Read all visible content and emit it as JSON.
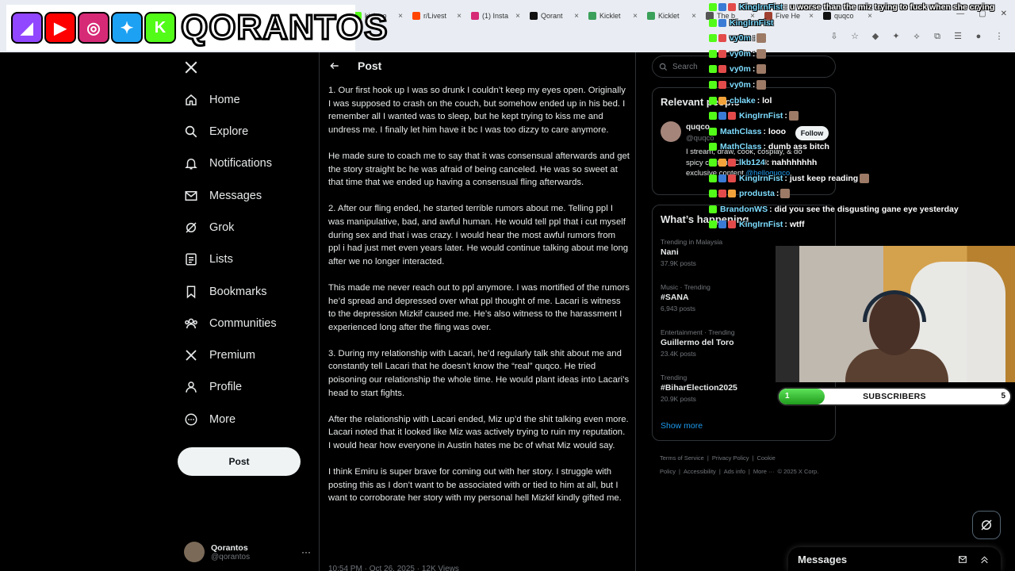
{
  "browser": {
    "tabs": [
      {
        "label": "kick.co",
        "color": "#53fc18"
      },
      {
        "label": "r/Livest",
        "color": "#ff4500"
      },
      {
        "label": "(1) Insta",
        "color": "#d62976"
      },
      {
        "label": "Qorant",
        "color": "#111111"
      },
      {
        "label": "Kicklet",
        "color": "#3aa05a"
      },
      {
        "label": "Kicklet",
        "color": "#3aa05a"
      },
      {
        "label": "The b",
        "color": "#555555"
      },
      {
        "label": "Five He",
        "color": "#a04030"
      },
      {
        "label": "quqco",
        "color": "#111111"
      }
    ]
  },
  "banner": {
    "name": "QORANTOS",
    "socials": [
      {
        "icon": "twitch-icon",
        "color": "#9146ff"
      },
      {
        "icon": "youtube-icon",
        "color": "#ff0000"
      },
      {
        "icon": "instagram-icon",
        "color": "#d62976"
      },
      {
        "icon": "twitter-icon",
        "color": "#1da1f2"
      },
      {
        "icon": "kick-icon",
        "color": "#53fc18"
      }
    ]
  },
  "nav": {
    "items": [
      {
        "label": "Home",
        "icon": "home-icon"
      },
      {
        "label": "Explore",
        "icon": "search-icon"
      },
      {
        "label": "Notifications",
        "icon": "bell-icon"
      },
      {
        "label": "Messages",
        "icon": "mail-icon"
      },
      {
        "label": "Grok",
        "icon": "grok-icon"
      },
      {
        "label": "Lists",
        "icon": "list-icon"
      },
      {
        "label": "Bookmarks",
        "icon": "bookmark-icon"
      },
      {
        "label": "Communities",
        "icon": "communities-icon"
      },
      {
        "label": "Premium",
        "icon": "x-icon"
      },
      {
        "label": "Profile",
        "icon": "profile-icon"
      },
      {
        "label": "More",
        "icon": "more-icon"
      }
    ],
    "post_button": "Post",
    "account": {
      "name": "Qorantos",
      "handle": "@qorantos",
      "more": "···"
    }
  },
  "main": {
    "title": "Post",
    "paragraphs": [
      "1. Our first hook up I was so drunk I couldn’t keep my eyes open. Originally I was supposed to crash on the couch, but somehow ended up in his bed. I remember all I wanted was to sleep, but he kept trying to kiss me and undress me. I finally let him have it bc I was too dizzy to care anymore.",
      "He made sure to coach me to say that it was consensual afterwards and get the story straight bc he was afraid of being canceled. He was so sweet at that time that we ended up having a consensual fling afterwards.",
      "2. After our fling ended, he started terrible rumors about me. Telling ppl I was manipulative, bad, and awful human. He would tell ppl that i cut myself during sex and that i was crazy. I would hear the most awful rumors from ppl i had just met even years later. He would continue talking about me long after we no longer interacted.",
      "This made me never reach out to ppl anymore. I was mortified of the rumors he’d spread and depressed over what ppl thought of me. Lacari is witness to the depression Mizkif caused me. He’s also witness to the harassment I experienced long after the fling was over.",
      "3. During my relationship with Lacari, he’d regularly talk shit about me and constantly tell Lacari that he doesn’t know the “real” quqco.  He tried poisoning our relationship the whole time. He would plant ideas into Lacari’s head to start fights.",
      "After the relationship with Lacari ended, Miz up’d the shit talking even more. Lacari noted that it looked like Miz was actively trying to ruin my reputation. I would hear how everyone in Austin hates me bc of what Miz would say.",
      "I think Emiru is super brave for coming out with her story. I struggle with posting this as I don’t want to be associated with or tied to him at all, but I want to corroborate her story with my personal hell Mizkif kindly gifted me."
    ],
    "meta": "10:54 PM · Oct 26, 2025 · 12K Views"
  },
  "right": {
    "search_placeholder": "Search",
    "relevant": {
      "title": "Relevant people",
      "name": "quqco",
      "handle": "@quqco",
      "bio": "I stream, draw, cook, cosplay, & do spicy content. Check link for exclusive content",
      "bio_link": "@helloquqco",
      "follow": "Follow"
    },
    "happening": {
      "title": "What’s happening",
      "trends": [
        {
          "context": "Trending in Malaysia",
          "name": "Nani",
          "count": "37.9K posts"
        },
        {
          "context": "Music · Trending",
          "name": "#SANA",
          "count": "6,943 posts"
        },
        {
          "context": "Entertainment · Trending",
          "name": "Guillermo del Toro",
          "count": "23.4K posts"
        },
        {
          "context": "Trending",
          "name": "#BiharElection2025",
          "count": "20.9K posts"
        }
      ],
      "show_more": "Show more"
    },
    "footer": [
      "Terms of Service",
      "|",
      "Privacy Policy",
      "|",
      "Cookie Policy",
      "|",
      "Accessibility",
      "|",
      "Ads info",
      "|",
      "More ···",
      "© 2025 X Corp."
    ]
  },
  "chat": {
    "messages": [
      {
        "user": "KingIrnFist",
        "text": ": u worse than the miz trying to fuck when she crying",
        "badges": [
          "b-kick",
          "b-blue",
          "b-red"
        ]
      },
      {
        "user": "KingIrnFist",
        "text": "",
        "badges": [
          "b-kick",
          "b-blue"
        ]
      },
      {
        "user": "vy0m",
        "text": ":",
        "badges": [
          "b-kick",
          "b-red"
        ],
        "emote": true
      },
      {
        "user": "vy0m",
        "text": ":",
        "badges": [
          "b-kick",
          "b-red"
        ],
        "emote": true
      },
      {
        "user": "vy0m",
        "text": ":",
        "badges": [
          "b-kick",
          "b-red"
        ],
        "emote": true
      },
      {
        "user": "vy0m",
        "text": ":",
        "badges": [
          "b-kick",
          "b-red"
        ],
        "emote": true
      },
      {
        "user": "cblake",
        "text": ": lol",
        "badges": [
          "b-kick",
          "b-orange"
        ]
      },
      {
        "user": "KingIrnFist",
        "text": ":",
        "badges": [
          "b-kick",
          "b-blue",
          "b-red"
        ],
        "emote": true
      },
      {
        "user": "MathClass",
        "text": ": looo",
        "badges": [
          "b-kick"
        ]
      },
      {
        "user": "MathClass",
        "text": ": dumb ass bitch",
        "badges": [
          "b-kick"
        ]
      },
      {
        "user": "lkb124",
        "text": ": nahhhhhhh",
        "badges": [
          "b-kick",
          "b-orange",
          "b-red"
        ]
      },
      {
        "user": "KingIrnFist",
        "text": ": just keep reading",
        "badges": [
          "b-kick",
          "b-blue",
          "b-red"
        ],
        "emote": true
      },
      {
        "user": "produsta",
        "text": ":",
        "badges": [
          "b-kick",
          "b-red",
          "b-orange"
        ],
        "emote": true
      },
      {
        "user": "BrandonWS",
        "text": ": did you see the disgusting gane eye   yesterday",
        "badges": [
          "b-kick"
        ]
      },
      {
        "user": "KingIrnFist",
        "text": ": wtff",
        "badges": [
          "b-kick",
          "b-blue",
          "b-red"
        ]
      }
    ]
  },
  "subs": {
    "current": "1",
    "label": "SUBSCRIBERS",
    "goal": "5",
    "progress": 0.2
  },
  "messages_drawer": {
    "title": "Messages"
  }
}
